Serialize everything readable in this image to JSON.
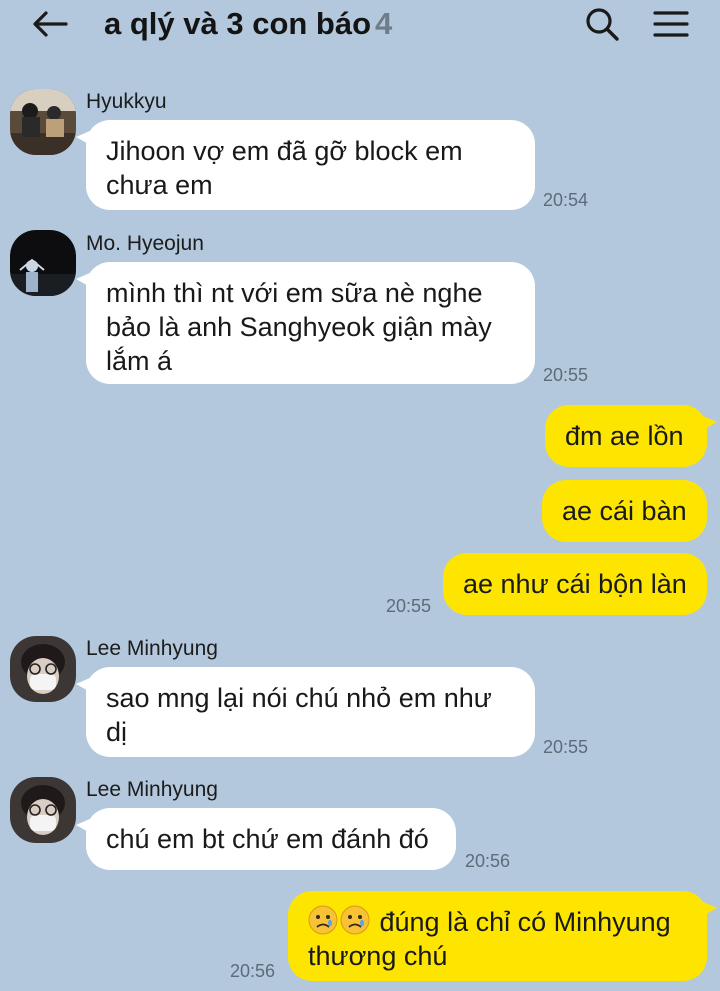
{
  "header": {
    "title": "a qlý và 3 con báo",
    "member_count": "4",
    "back_icon": "arrow-left-icon",
    "search_icon": "search-icon",
    "menu_icon": "hamburger-menu-icon"
  },
  "colors": {
    "background": "#b3c8dd",
    "incoming_bubble": "#ffffff",
    "outgoing_bubble": "#fee500"
  },
  "messages": [
    {
      "sender": "Hyukkyu",
      "text": "Jihoon vợ em đã gỡ block em\nchưa em",
      "time": "20:54"
    },
    {
      "sender": "Mo. Hyeojun",
      "text": "mình thì nt với em sữa nè nghe\nbảo là anh Sanghyeok giận mày\nlắm á",
      "time": "20:55"
    },
    {
      "text": "đm ae lồn"
    },
    {
      "text": "ae cái bàn"
    },
    {
      "text": "ae như cái bộn làn",
      "time": "20:55"
    },
    {
      "sender": "Lee Minhyung",
      "text": "sao mng lại nói chú nhỏ em như\ndị",
      "time": "20:55"
    },
    {
      "sender": "Lee Minhyung",
      "text": "chú em bt chứ em đánh đó",
      "time": "20:56"
    },
    {
      "emoji": [
        "crying-face-emoji",
        "crying-face-emoji"
      ],
      "text": " đúng là chỉ có Minhyung\nthương chú",
      "time": "20:56"
    }
  ]
}
